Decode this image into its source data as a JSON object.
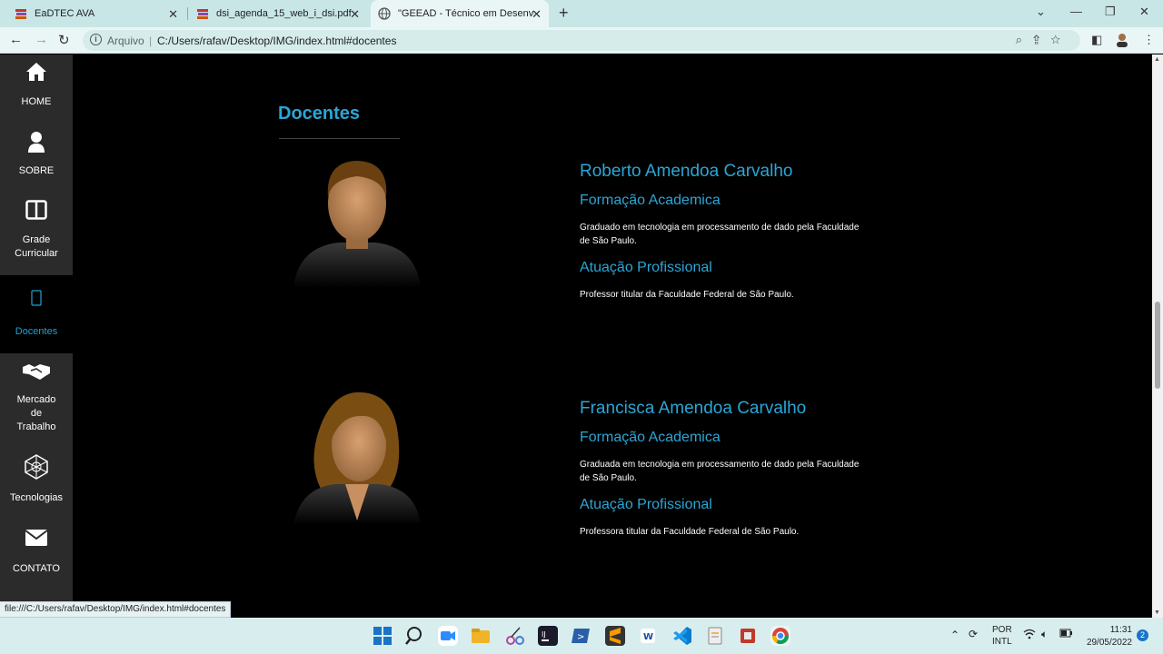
{
  "browser": {
    "tabs": [
      {
        "title": "EaDTEC AVA",
        "active": false
      },
      {
        "title": "dsi_agenda_15_web_i_dsi.pdf",
        "active": false
      },
      {
        "title": "\"GEEAD - Técnico em Desenvolvi",
        "active": true
      }
    ],
    "address_label": "Arquivo",
    "url": "C:/Users/rafav/Desktop/IMG/index.html#docentes"
  },
  "sidebar": {
    "items": [
      {
        "label": "HOME",
        "icon": "home-icon"
      },
      {
        "label": "SOBRE",
        "icon": "user-icon"
      },
      {
        "label": "Grade Curricular",
        "icon": "columns-icon"
      },
      {
        "label": "Docentes",
        "icon": "mobile-icon",
        "active": true
      },
      {
        "label": "Mercado de Trabalho",
        "icon": "handshake-icon"
      },
      {
        "label": "Tecnologias",
        "icon": "network-icon"
      },
      {
        "label": "CONTATO",
        "icon": "envelope-icon"
      }
    ]
  },
  "section": {
    "title": "Docentes"
  },
  "docentes": [
    {
      "name": "Roberto Amendoa Carvalho",
      "formacao_title": "Formação Academica",
      "formacao_text": "Graduado em tecnologia em processamento de dado pela Faculdade de São Paulo.",
      "atuacao_title": "Atuação Profissional",
      "atuacao_text": "Professor titular da Faculdade Federal de São Paulo."
    },
    {
      "name": "Francisca Amendoa Carvalho",
      "formacao_title": "Formação Academica",
      "formacao_text": "Graduada em tecnologia em processamento de dado pela Faculdade de São Paulo.",
      "atuacao_title": "Atuação Profissional",
      "atuacao_text": "Professora titular da Faculdade Federal de São Paulo."
    }
  ],
  "status_url": "file:///C:/Users/rafav/Desktop/IMG/index.html#docentes",
  "taskbar": {
    "lang": "POR",
    "layout": "INTL",
    "time": "11:31",
    "date": "29/05/2022",
    "notifications": "2"
  },
  "colors": {
    "accent": "#2aa6d6",
    "sidebar": "#2b2b2b",
    "background": "#000000"
  }
}
